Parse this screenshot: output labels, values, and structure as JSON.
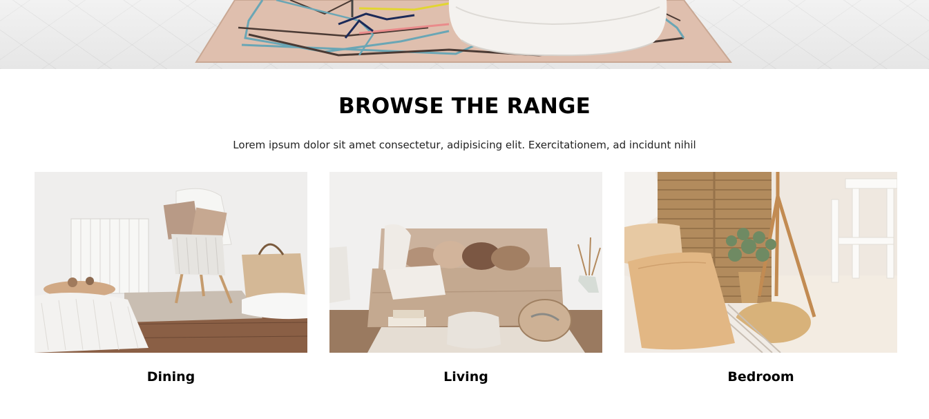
{
  "hero": {
    "image_name": "patterned-rug-with-white-bean-bag-image"
  },
  "browse": {
    "title": "BROWSE THE RANGE",
    "subtitle": "Lorem ipsum dolor sit amet consectetur, adipisicing elit. Exercitationem, ad incidunt nihil"
  },
  "categories": [
    {
      "label": "Dining",
      "image_name": "dining-room-photo"
    },
    {
      "label": "Living",
      "image_name": "living-room-photo"
    },
    {
      "label": "Bedroom",
      "image_name": "bedroom-photo"
    }
  ]
}
